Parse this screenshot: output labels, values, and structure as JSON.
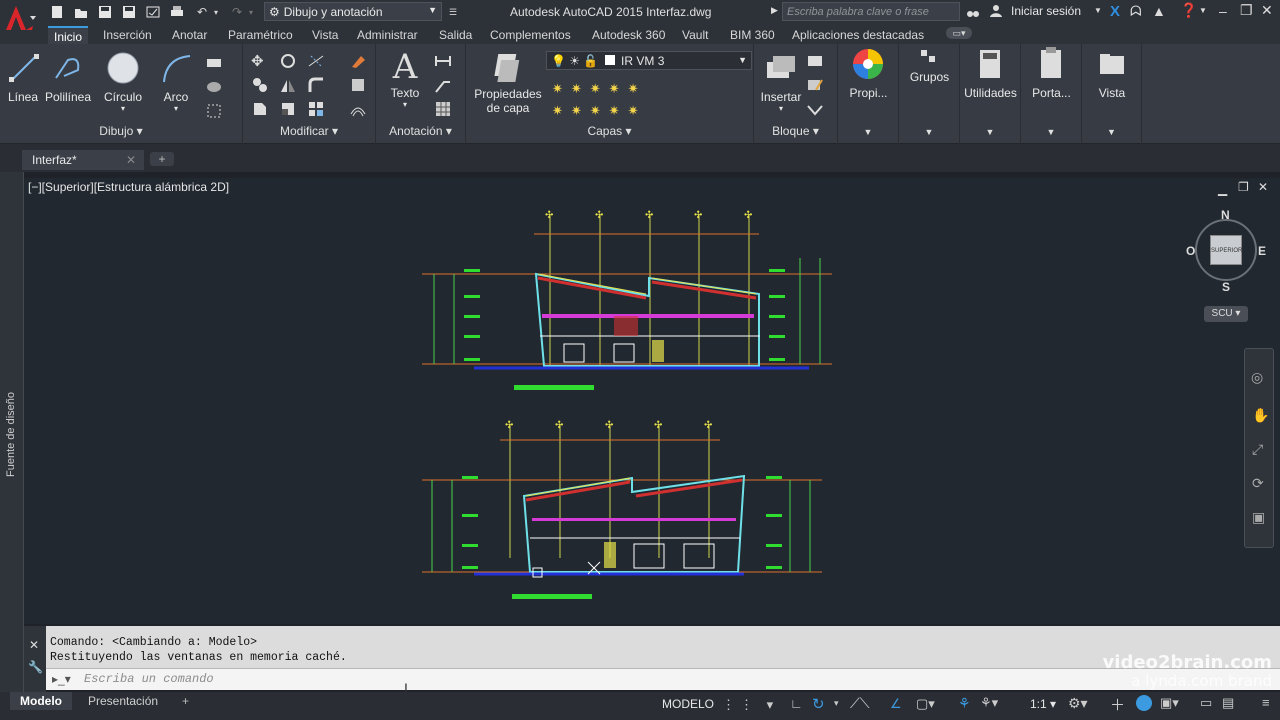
{
  "titlebar": {
    "workspace": "Dibujo y anotación",
    "title": "Autodesk AutoCAD 2015   Interfaz.dwg",
    "search_placeholder": "Escriba palabra clave o frase",
    "signin": "Iniciar sesión"
  },
  "ribbon_tabs": [
    "Inicio",
    "Inserción",
    "Anotar",
    "Paramétrico",
    "Vista",
    "Administrar",
    "Salida",
    "Complementos",
    "Autodesk 360",
    "Vault",
    "BIM 360",
    "Aplicaciones destacadas"
  ],
  "ribbon": {
    "draw": {
      "panel": "Dibujo",
      "line": "Línea",
      "polyline": "Polilínea",
      "circle": "Círculo",
      "arc": "Arco"
    },
    "modify": {
      "panel": "Modificar"
    },
    "annotation": {
      "panel": "Anotación",
      "text": "Texto"
    },
    "layers": {
      "panel": "Capas",
      "props_line1": "Propiedades",
      "props_line2": "de capa",
      "current_layer": "IR VM 3"
    },
    "block": {
      "panel": "Bloque",
      "insert": "Insertar"
    },
    "properties": {
      "label": "Propi..."
    },
    "groups": {
      "label": "Grupos"
    },
    "utilities": {
      "label": "Utilidades"
    },
    "clipboard": {
      "label": "Porta..."
    },
    "view": {
      "label": "Vista"
    }
  },
  "filetab": {
    "name": "Interfaz*"
  },
  "left_palette": {
    "label": "Fuente de diseño"
  },
  "viewport": {
    "label": "[−][Superior][Estructura alámbrica 2D]"
  },
  "viewcube": {
    "north": "N",
    "south": "S",
    "east": "E",
    "west": "O",
    "face": "SUPERIOR",
    "ucs": "SCU"
  },
  "command": {
    "history": [
      "Comando:   <Cambiando a: Modelo>",
      "Restituyendo las ventanas en memoria caché."
    ],
    "placeholder": "Escriba un comando"
  },
  "layout_tabs": [
    "Modelo",
    "Presentación"
  ],
  "status": {
    "mode": "MODELO",
    "scale": "1:1"
  },
  "brand": {
    "line1": "video2brain.com",
    "line2": "a lynda.com brand"
  },
  "colors": {
    "accent": "#3c9ae0",
    "canvas": "#212830",
    "ribbon": "#373c44"
  }
}
